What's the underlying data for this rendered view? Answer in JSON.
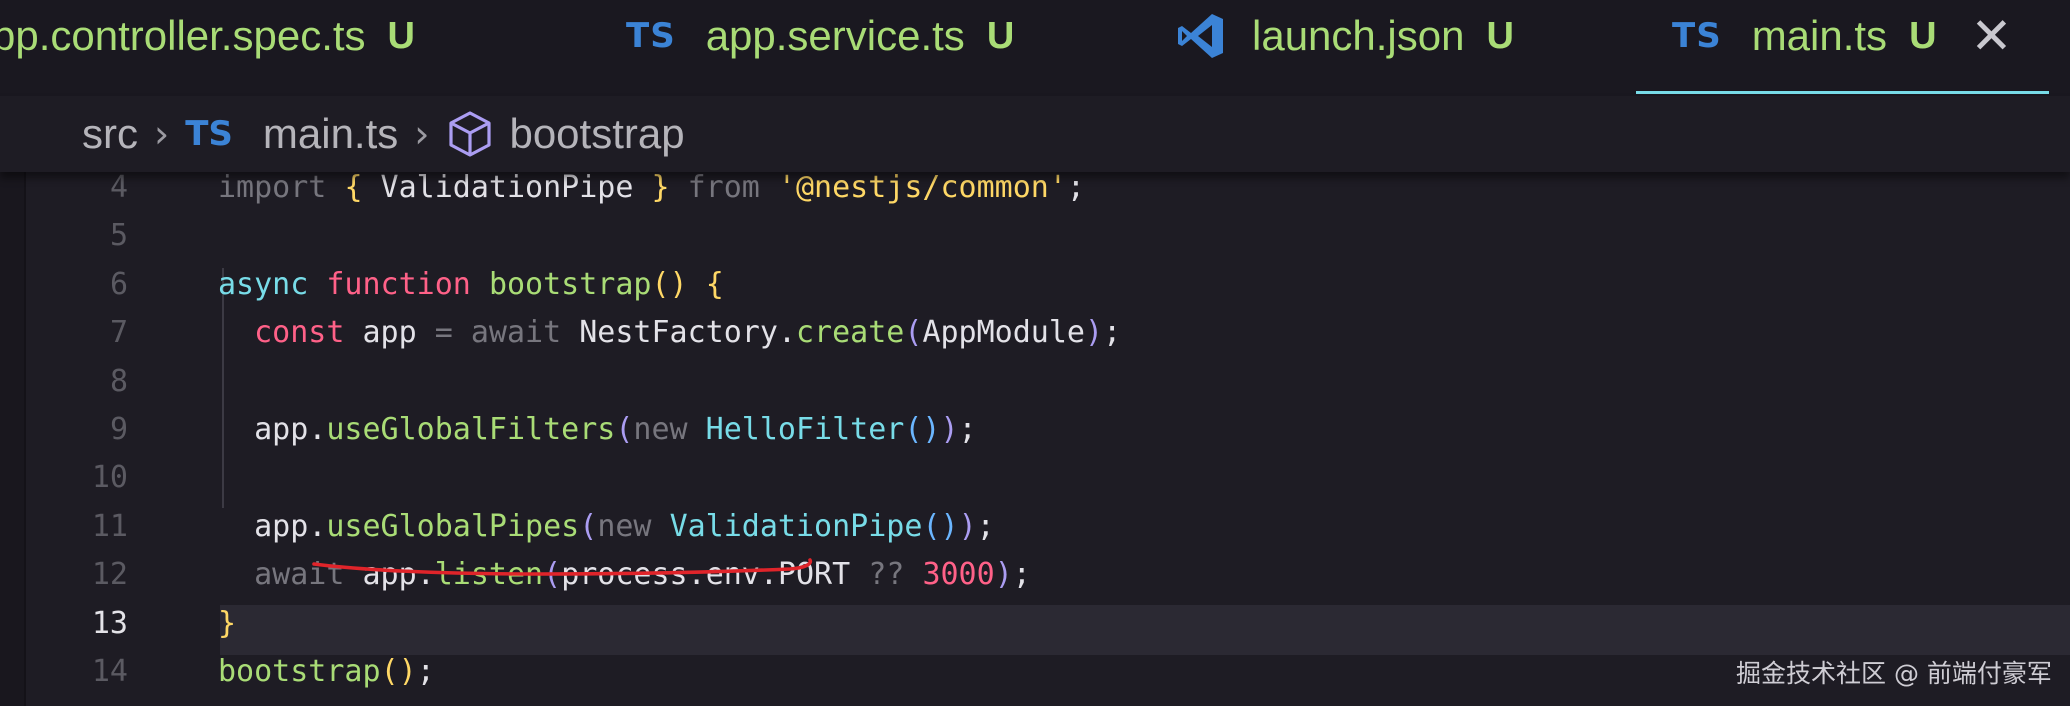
{
  "tabs": [
    {
      "name": "pp.controller.spec.ts",
      "status": "U",
      "icon": "typescript-icon",
      "active": false
    },
    {
      "name": "app.service.ts",
      "status": "U",
      "icon": "typescript-icon",
      "icon_label": "TS",
      "active": false
    },
    {
      "name": "launch.json",
      "status": "U",
      "icon": "vscode-icon",
      "active": false
    },
    {
      "name": "main.ts",
      "status": "U",
      "icon": "typescript-icon",
      "icon_label": "TS",
      "active": true,
      "close_glyph": "✕"
    }
  ],
  "breadcrumb": {
    "folder": "src",
    "separator": "›",
    "file_icon_label": "TS",
    "file": "main.ts",
    "symbol_icon": "symbol-method-cube-icon",
    "symbol": "bootstrap"
  },
  "editor": {
    "current_line": 13,
    "lines": [
      {
        "num": "4",
        "tokens": [
          {
            "t": "import ",
            "c": "dim"
          },
          {
            "t": "{",
            "c": "br1"
          },
          {
            "t": " ValidationPipe ",
            "c": "plain"
          },
          {
            "t": "}",
            "c": "br1"
          },
          {
            "t": " from ",
            "c": "dim"
          },
          {
            "t": "'@nestjs/common'",
            "c": "str"
          },
          {
            "t": ";",
            "c": "plain"
          }
        ]
      },
      {
        "num": "5",
        "tokens": []
      },
      {
        "num": "6",
        "tokens": [
          {
            "t": "async ",
            "c": "cls"
          },
          {
            "t": "function ",
            "c": "kw"
          },
          {
            "t": "bootstrap",
            "c": "fn"
          },
          {
            "t": "()",
            "c": "br1"
          },
          {
            "t": " ",
            "c": "plain"
          },
          {
            "t": "{",
            "c": "br1"
          }
        ]
      },
      {
        "num": "7",
        "tokens": [
          {
            "t": "  ",
            "c": "plain"
          },
          {
            "t": "const ",
            "c": "kw"
          },
          {
            "t": "app ",
            "c": "plain"
          },
          {
            "t": "= ",
            "c": "dim"
          },
          {
            "t": "await ",
            "c": "dim"
          },
          {
            "t": "NestFactory",
            "c": "plain"
          },
          {
            "t": ".",
            "c": "plain"
          },
          {
            "t": "create",
            "c": "meth"
          },
          {
            "t": "(",
            "c": "br2"
          },
          {
            "t": "AppModule",
            "c": "plain"
          },
          {
            "t": ")",
            "c": "br2"
          },
          {
            "t": ";",
            "c": "plain"
          }
        ]
      },
      {
        "num": "8",
        "tokens": []
      },
      {
        "num": "9",
        "tokens": [
          {
            "t": "  app",
            "c": "plain"
          },
          {
            "t": ".",
            "c": "plain"
          },
          {
            "t": "useGlobalFilters",
            "c": "meth"
          },
          {
            "t": "(",
            "c": "br2"
          },
          {
            "t": "new ",
            "c": "dim"
          },
          {
            "t": "HelloFilter",
            "c": "cls"
          },
          {
            "t": "()",
            "c": "br3"
          },
          {
            "t": ")",
            "c": "br2"
          },
          {
            "t": ";",
            "c": "plain"
          }
        ]
      },
      {
        "num": "10",
        "tokens": []
      },
      {
        "num": "11",
        "tokens": [
          {
            "t": "  app",
            "c": "plain"
          },
          {
            "t": ".",
            "c": "plain"
          },
          {
            "t": "useGlobalPipes",
            "c": "meth"
          },
          {
            "t": "(",
            "c": "br2"
          },
          {
            "t": "new ",
            "c": "dim"
          },
          {
            "t": "ValidationPipe",
            "c": "cls"
          },
          {
            "t": "()",
            "c": "br3"
          },
          {
            "t": ")",
            "c": "br2"
          },
          {
            "t": ";",
            "c": "plain"
          }
        ]
      },
      {
        "num": "12",
        "tokens": [
          {
            "t": "  await ",
            "c": "dim"
          },
          {
            "t": "app",
            "c": "plain"
          },
          {
            "t": ".",
            "c": "plain"
          },
          {
            "t": "listen",
            "c": "meth"
          },
          {
            "t": "(",
            "c": "br2"
          },
          {
            "t": "process",
            "c": "plain"
          },
          {
            "t": ".",
            "c": "plain"
          },
          {
            "t": "env",
            "c": "plain"
          },
          {
            "t": ".",
            "c": "plain"
          },
          {
            "t": "PORT ",
            "c": "plain"
          },
          {
            "t": "?? ",
            "c": "dim"
          },
          {
            "t": "3000",
            "c": "num"
          },
          {
            "t": ")",
            "c": "br2"
          },
          {
            "t": ";",
            "c": "plain"
          }
        ]
      },
      {
        "num": "13",
        "tokens": [
          {
            "t": "}",
            "c": "br1"
          }
        ]
      },
      {
        "num": "14",
        "tokens": [
          {
            "t": "bootstrap",
            "c": "fn"
          },
          {
            "t": "()",
            "c": "br1"
          },
          {
            "t": ";",
            "c": "plain"
          }
        ]
      }
    ]
  },
  "annotation": {
    "kind": "red-underline",
    "color": "#e0242a"
  },
  "watermark": "掘金技术社区 @ 前端付豪军",
  "colors": {
    "background": "#1e1c24",
    "tab_text": "#a9dc76",
    "ts_icon": "#3b83d6",
    "active_underline": "#78dce8",
    "vscode_blue": "#3b83d6"
  }
}
